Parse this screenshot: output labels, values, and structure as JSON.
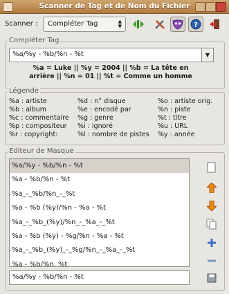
{
  "window": {
    "title": "Scanner de Tag et de Nom du Fichier"
  },
  "toolbar": {
    "scanner_label": "Scanner :",
    "mode_selected": "Compléter Tag",
    "icons": [
      "green-arrows-icon",
      "tools-icon",
      "mask-icon",
      "help-icon",
      "exit-icon"
    ]
  },
  "complete_tag": {
    "section_title": "Compléter Tag",
    "mask_value": "%a/%y - %b/%n - %t",
    "preview_line1": "%a = Luke || %y = 2004 || %b = La tête en",
    "preview_line2": "arrière || %n = 01 || %t = Comme un homme",
    "preview": [
      {
        "code": "%a",
        "value": "Luke"
      },
      {
        "code": "%y",
        "value": "2004"
      },
      {
        "code": "%b",
        "value": "La tête en arrière"
      },
      {
        "code": "%n",
        "value": "01"
      },
      {
        "code": "%t",
        "value": "Comme un homme"
      }
    ]
  },
  "legend": {
    "section_title": "Légende",
    "col1": [
      "%a : artiste",
      "%b : album",
      "%c : commentaire",
      "%p : compositeur",
      "%r : copyright:"
    ],
    "col2": [
      "%d : n° disque",
      "%e : encodé par",
      "%g : genre",
      "%i : ignoré",
      "%l : nombre de pistes"
    ],
    "col3": [
      "%o : artiste orig.",
      "%n : piste",
      "%t : titre",
      "%u : URL",
      "%y : année"
    ]
  },
  "mask_editor": {
    "section_title": "Editeur de Masque",
    "items": [
      "%a/%y - %b/%n - %t",
      "%a - %b/%n - %t",
      "%a_-_%b/%n_-_%t",
      "%a - %b (%y)/%n - %a - %t",
      "%a_-_%b_(%y)/%n_-_%a_-_%t",
      "%a - %b (%y) - %g/%n - %a - %t",
      "%a_-_%b_(%y)_-_%g/%n_-_%a_-_%t",
      "%a - %b/%n. %t"
    ],
    "selected_index": 0,
    "edit_value": "%a/%y - %b/%n - %t",
    "buttons": [
      "new-icon",
      "move-up-icon",
      "move-down-icon",
      "duplicate-icon",
      "add-icon",
      "remove-icon",
      "save-icon"
    ]
  },
  "colors": {
    "titlebar": "#b98548",
    "selection": "#d5d2cc",
    "up_down_arrows": "#e8891a",
    "help_blue": "#2a5fb0"
  }
}
